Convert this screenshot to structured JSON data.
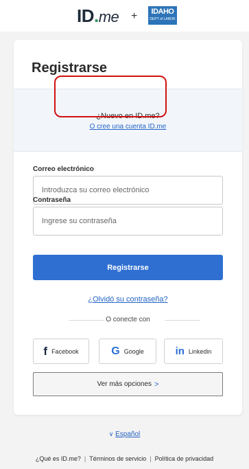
{
  "header": {
    "logo_main": "ID",
    "logo_dot": ".",
    "logo_suffix": "me",
    "plus": "+",
    "partner_logo_big": "IDAHO",
    "partner_logo_small": "DEPT of LABOR"
  },
  "card": {
    "title": "Registrarse",
    "new_question": "¿Nuevo en ID.me?",
    "new_link": "O cree una cuenta ID.me",
    "email_label": "Correo electrónico",
    "email_placeholder": "Introduzca su correo electrónico",
    "email_value": "",
    "password_label": "Contraseña",
    "password_placeholder": "Ingrese su contraseña",
    "password_value": "",
    "submit_label": "Registrarse",
    "forgot_label": "¿Olvidó su contraseña?",
    "or_connect": "O conecte con",
    "social": {
      "facebook_icon": "f",
      "facebook_label": "Facebook",
      "google_icon": "G",
      "google_label": "Google",
      "linkedin_icon": "in",
      "linkedin_label": "Linkedin"
    },
    "more_options": "Ver más opciones",
    "more_chevron": ">"
  },
  "language": {
    "chevron": "∨",
    "label": "Español"
  },
  "footer": {
    "links": [
      "¿Qué es ID.me?",
      "Términos de servicio",
      "Política de privacidad"
    ],
    "separator": "|"
  },
  "colors": {
    "primary": "#2f6fd1",
    "link": "#2463c4",
    "highlight": "#d01010"
  }
}
